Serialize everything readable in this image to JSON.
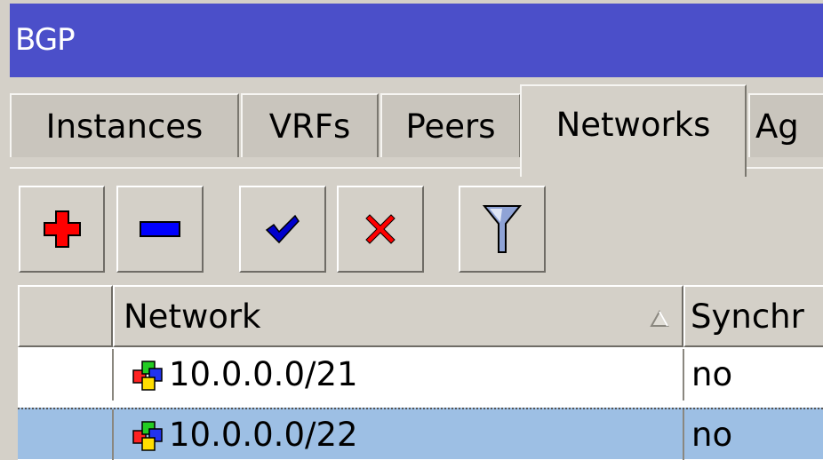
{
  "window": {
    "title": "BGP"
  },
  "tabs": [
    {
      "label": "Instances",
      "active": false
    },
    {
      "label": "VRFs",
      "active": false
    },
    {
      "label": "Peers",
      "active": false
    },
    {
      "label": "Networks",
      "active": true
    },
    {
      "label": "Ag",
      "active": false
    }
  ],
  "toolbar": {
    "buttons": [
      {
        "icon": "plus-icon",
        "color": "#ff0000"
      },
      {
        "icon": "minus-icon",
        "color": "#0000ff"
      },
      {
        "icon": "checkmark-icon",
        "color": "#0000cc"
      },
      {
        "icon": "x-icon",
        "color": "#ff0000"
      },
      {
        "icon": "filter-icon",
        "color": "#4f5ea8"
      }
    ]
  },
  "table": {
    "columns": [
      {
        "label": ""
      },
      {
        "label": "Network",
        "sort": "ascending"
      },
      {
        "label": "Synchr"
      }
    ],
    "rows": [
      {
        "network": "10.0.0.0/21",
        "synchronize": "no",
        "selected": false
      },
      {
        "network": "10.0.0.0/22",
        "synchronize": "no",
        "selected": true
      }
    ]
  }
}
